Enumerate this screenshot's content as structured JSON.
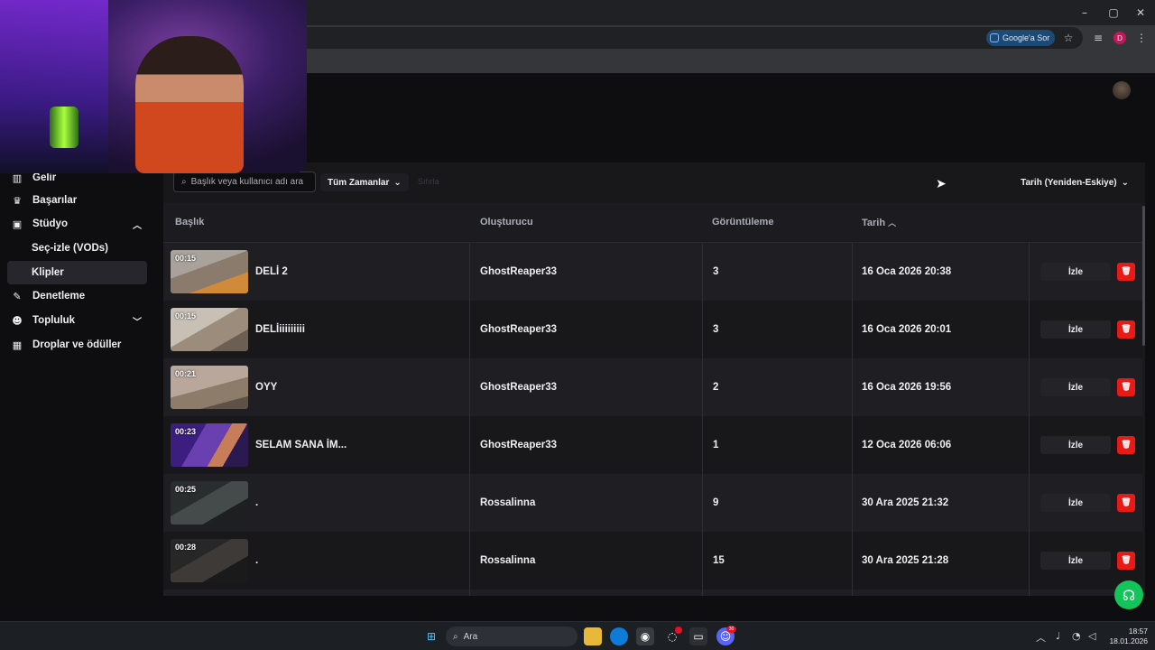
{
  "browser": {
    "window_controls": {
      "minimize": "–",
      "maximize": "▢",
      "close": "✕"
    },
    "google_sor_label": "Google'a Sor",
    "profile_initial": "D"
  },
  "sidebar": {
    "items": [
      {
        "label": "Gelir",
        "icon": "chart-icon"
      },
      {
        "label": "Başarılar",
        "icon": "trophy-icon"
      },
      {
        "label": "Stüdyo",
        "icon": "film-icon",
        "expanded": true
      },
      {
        "label": "Seç-izle (VODs)",
        "sub": true
      },
      {
        "label": "Klipler",
        "sub": true,
        "active": true
      },
      {
        "label": "Denetleme",
        "icon": "wrench-icon"
      },
      {
        "label": "Topluluk",
        "icon": "people-icon",
        "expanded": false
      },
      {
        "label": "Droplar ve ödüller",
        "icon": "gift-icon"
      }
    ]
  },
  "filters": {
    "search_placeholder": "Başlık veya kullanıcı adı ara",
    "time_range": "Tüm Zamanlar",
    "faded_label": "Sıfırla",
    "sort": "Tarih (Yeniden-Eskiye)"
  },
  "table": {
    "headers": {
      "title": "Başlık",
      "creator": "Oluşturucu",
      "views": "Görüntüleme",
      "date": "Tarih"
    },
    "rows": [
      {
        "duration": "00:15",
        "title": "DELİ 2",
        "creator": "GhostReaper33",
        "views": "3",
        "date": "16 Oca 2026 20:38",
        "action": "İzle"
      },
      {
        "duration": "00:15",
        "title": "DELİiiiiiiiii",
        "creator": "GhostReaper33",
        "views": "3",
        "date": "16 Oca 2026 20:01",
        "action": "İzle"
      },
      {
        "duration": "00:21",
        "title": "OYY",
        "creator": "GhostReaper33",
        "views": "2",
        "date": "16 Oca 2026 19:56",
        "action": "İzle"
      },
      {
        "duration": "00:23",
        "title": "SELAM SANA İM...",
        "creator": "GhostReaper33",
        "views": "1",
        "date": "12 Oca 2026 06:06",
        "action": "İzle"
      },
      {
        "duration": "00:25",
        "title": ".",
        "creator": "Rossalinna",
        "views": "9",
        "date": "30 Ara 2025 21:32",
        "action": "İzle"
      },
      {
        "duration": "00:28",
        "title": ".",
        "creator": "Rossalinna",
        "views": "15",
        "date": "30 Ara 2025 21:28",
        "action": "İzle"
      }
    ]
  },
  "taskbar": {
    "search_label": "Ara",
    "time": "18:57",
    "date": "18.01.2026",
    "discord_badge": "30"
  },
  "colors": {
    "accent_green": "#12c45a",
    "delete_red": "#e91916",
    "background": "#0e0e10",
    "panel": "#18181b"
  }
}
